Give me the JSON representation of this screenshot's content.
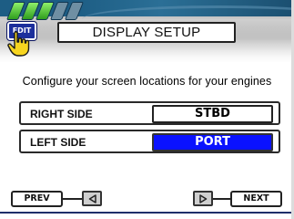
{
  "header": {
    "title": "DISPLAY SETUP",
    "edit_icon_label": "EDIT",
    "signal_bars": {
      "active": 3,
      "total": 5
    }
  },
  "prompt": "Configure your screen locations for your engines",
  "rows": [
    {
      "label": "RIGHT SIDE",
      "value": "STBD",
      "selected": false
    },
    {
      "label": "LEFT SIDE",
      "value": "PORT",
      "selected": true
    }
  ],
  "nav": {
    "prev_label": "PREV",
    "next_label": "NEXT"
  },
  "colors": {
    "header_blue": "#1d5d84",
    "selection_blue": "#0a12ff",
    "signal_green": "#2f9e1d",
    "edit_blue": "#1c2f9c",
    "hand_yellow": "#f7d520"
  },
  "icons": [
    "signal-bars-icon",
    "edit-icon",
    "pointer-hand-icon",
    "left-arrow-icon",
    "right-arrow-icon"
  ]
}
